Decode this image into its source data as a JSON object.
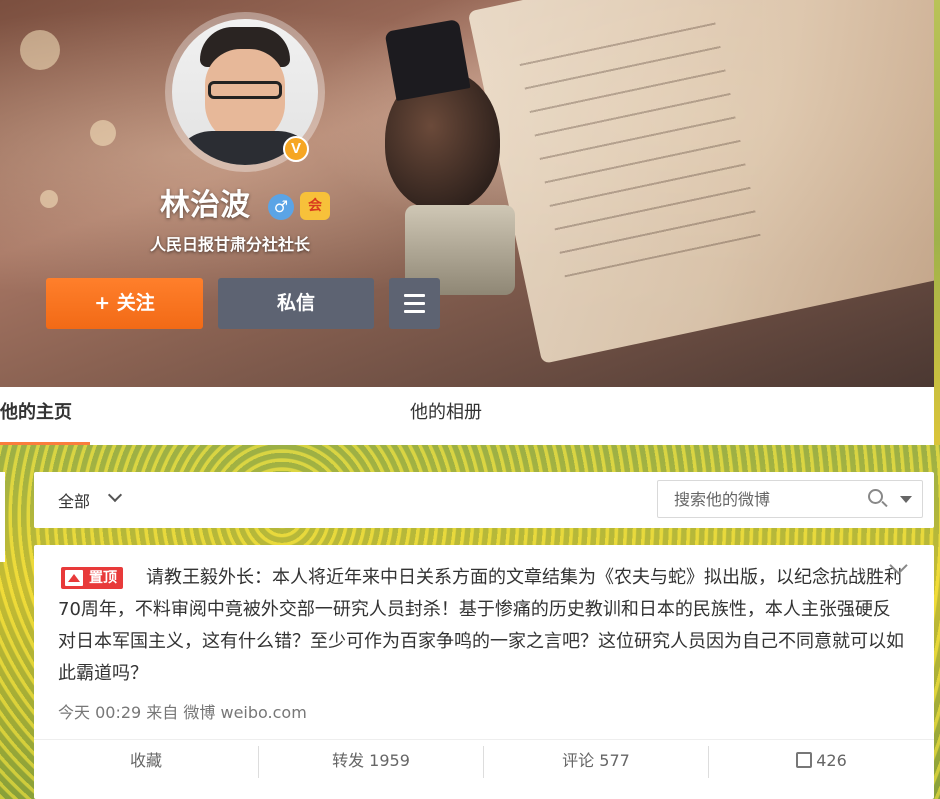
{
  "profile": {
    "name": "林治波",
    "verified_mark": "V",
    "gender_symbol": "♂",
    "level_label": "会",
    "bio": "人民日报甘肃分社社长"
  },
  "buttons": {
    "follow": "+ 关注",
    "message": "私信"
  },
  "tabs": {
    "home": "他的主页",
    "album": "他的相册"
  },
  "filter": {
    "all_label": "全部",
    "search_placeholder": "搜索他的微博"
  },
  "post": {
    "pin_label": "置顶",
    "text": "请教王毅外长：本人将近年来中日关系方面的文章结集为《农夫与蛇》拟出版，以纪念抗战胜利70周年，不料审阅中竟被外交部一研究人员封杀！基于惨痛的历史教训和日本的民族性，本人主张强硬反对日本军国主义，这有什么错？至少可作为百家争鸣的一家之言吧？这位研究人员因为自己不同意就可以如此霸道吗？",
    "time": "今天 00:29",
    "from_label": "来自",
    "source": "微博 weibo.com",
    "actions": {
      "favorite": "收藏",
      "repost": "转发 1959",
      "comment": "评论 577",
      "like_count": "426"
    }
  },
  "colors": {
    "follow_button": "#f26a16",
    "tab_underline": "#fa7d3c",
    "pin_badge": "#e83a3a"
  }
}
